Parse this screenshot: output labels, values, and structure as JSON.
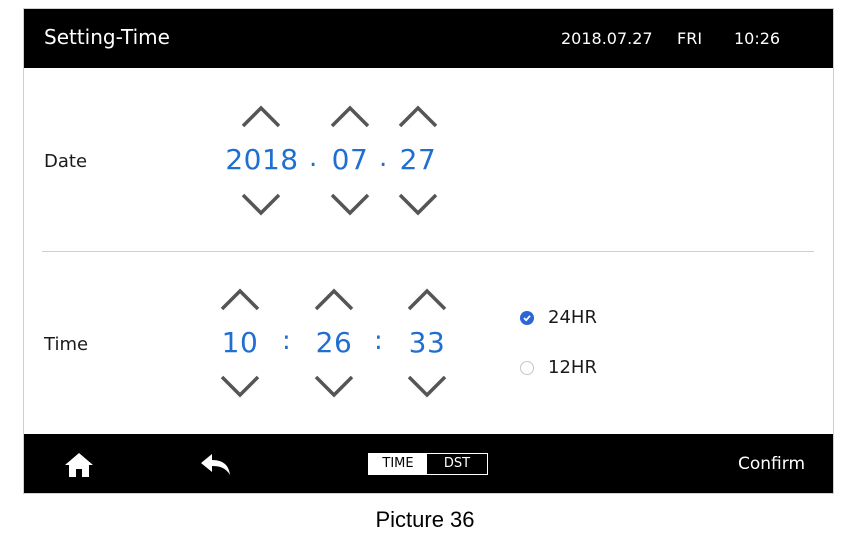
{
  "header": {
    "title": "Setting-Time",
    "date": "2018.07.27",
    "day": "FRI",
    "time": "10:26"
  },
  "date_row": {
    "label": "Date",
    "year": "2018",
    "month": "07",
    "day": "27",
    "separator": "."
  },
  "time_row": {
    "label": "Time",
    "hour": "10",
    "minute": "26",
    "second": "33",
    "separator": ":"
  },
  "format": {
    "option_24": "24HR",
    "option_12": "12HR",
    "selected": "24HR"
  },
  "footer": {
    "tab_time": "TIME",
    "tab_dst": "DST",
    "confirm": "Confirm",
    "active_tab": "TIME"
  },
  "caption": "Picture 36",
  "colors": {
    "value_blue": "#1f6fd1",
    "radio_blue": "#2a66d4",
    "bar": "#000000"
  },
  "icons": {
    "increment": "chevron-up-icon",
    "decrement": "chevron-down-icon",
    "home": "home-icon",
    "back": "back-arrow-icon"
  }
}
